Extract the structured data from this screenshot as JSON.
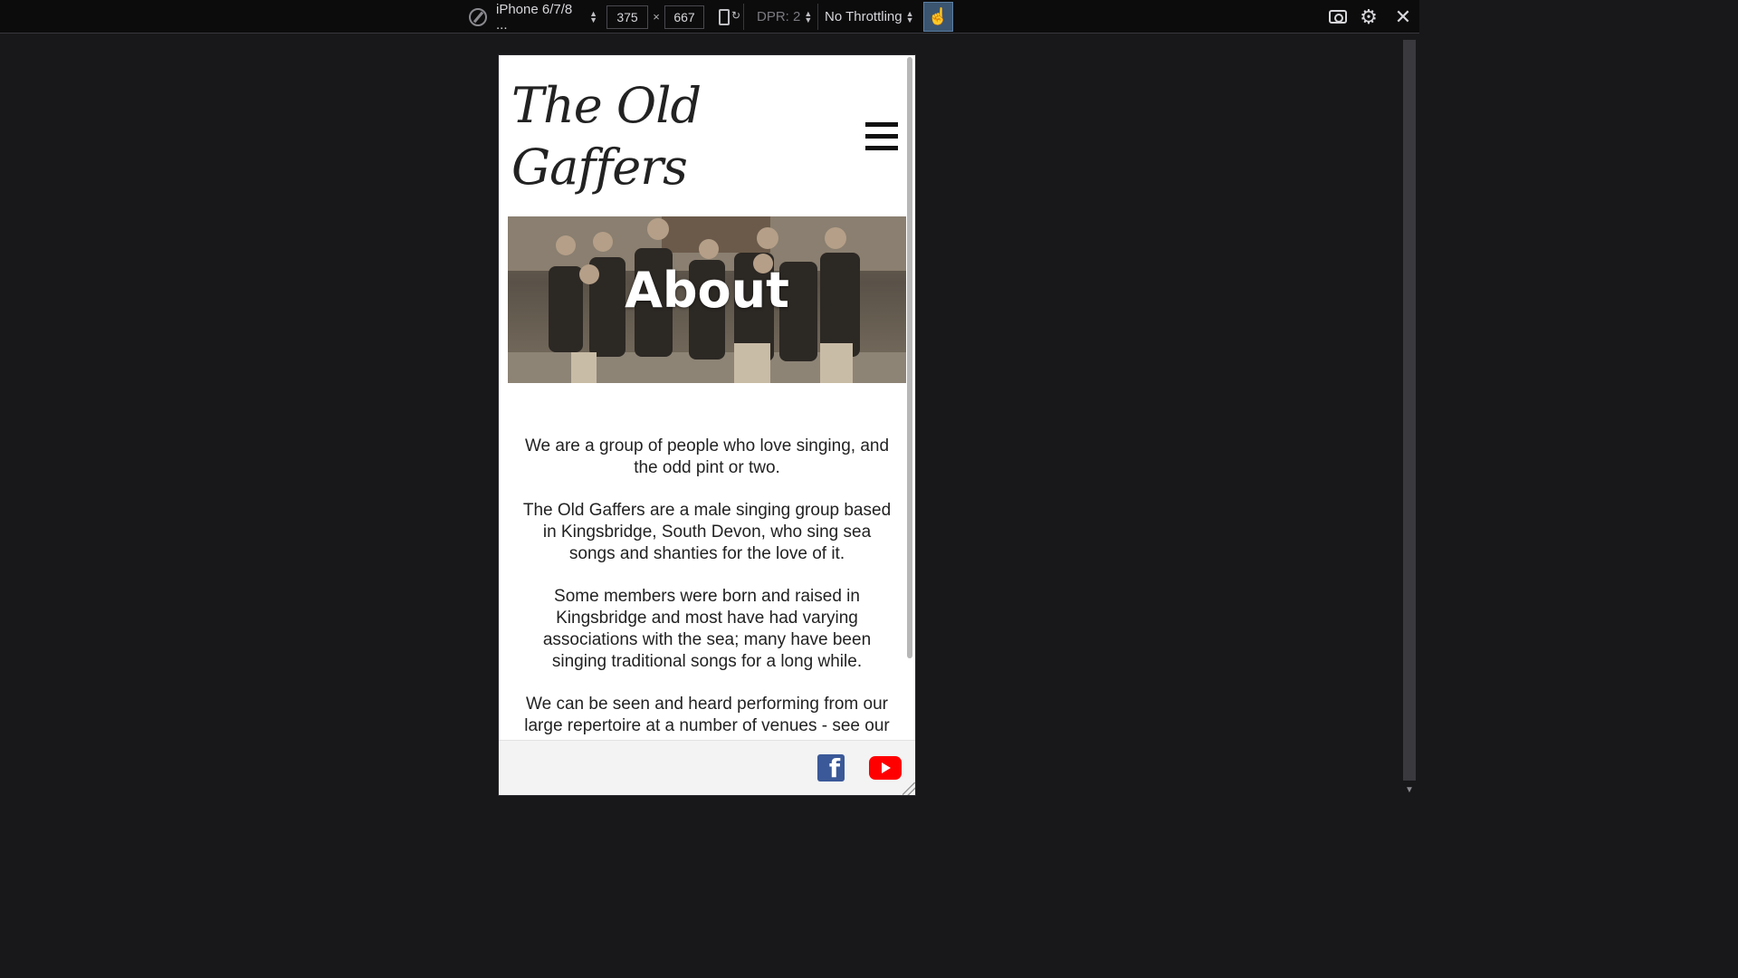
{
  "toolbar": {
    "device_label": "iPhone 6/7/8 ...",
    "width_value": "375",
    "times_symbol": "×",
    "height_value": "667",
    "dpr_label": "DPR: 2",
    "throttling_label": "No Throttling",
    "icons": [
      "compass-icon",
      "rotate-icon",
      "touch-icon",
      "screenshot-icon",
      "gear-icon",
      "close-icon"
    ]
  },
  "site": {
    "title_line1": "The Old",
    "title_line2": "Gaffers",
    "hero_title": "About",
    "paragraphs": [
      "We are a group of people who love singing, and the odd pint or two.",
      "The Old Gaffers are a male singing group based in Kingsbridge, South Devon, who sing sea songs and shanties for the love of it.",
      "Some members were born and raised in Kingsbridge and most have had varying associations with the sea; many have been singing traditional songs for a long while.",
      "We can be seen and heard performing from our large repertoire at a number of venues - see our"
    ],
    "footer_icons": [
      "facebook-icon",
      "youtube-icon"
    ]
  },
  "colors": {
    "devtools_bg": "#0c0c0d",
    "page_bg": "#18181a",
    "touch_active": "#3b5570",
    "facebook": "#3b5998",
    "youtube": "#ff0000"
  }
}
